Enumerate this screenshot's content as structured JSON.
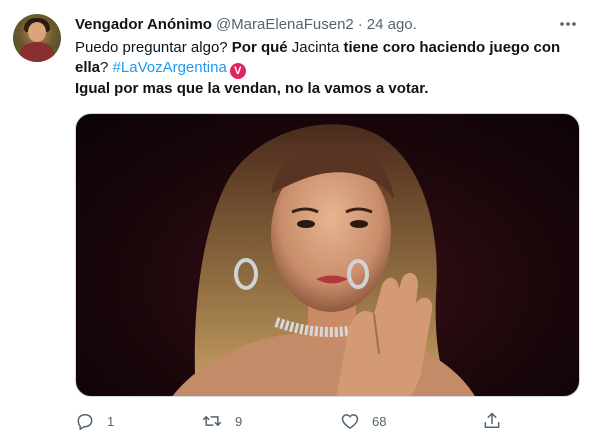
{
  "tweet": {
    "author_name": "Vengador Anónimo",
    "author_handle": "@MaraElenaFusen2",
    "separator": "·",
    "date": "24 ago.",
    "text": {
      "part1": "Puedo preguntar algo? ",
      "part2_bold": "Por qué",
      "part3": " Jacinta ",
      "part4_bold": "tiene coro haciendo juego con ella",
      "part5": "? ",
      "hashtag": "#LaVozArgentina",
      "hashtag_emoji": "V",
      "line2_bold": "Igual por mas que la vendan, no la vamos a votar."
    },
    "actions": {
      "replies": "1",
      "retweets": "9",
      "likes": "68"
    },
    "icons": {
      "more": "more-dots-icon",
      "reply": "reply-icon",
      "retweet": "retweet-icon",
      "like": "heart-icon",
      "share": "share-icon"
    },
    "colors": {
      "link": "#1d9bf0",
      "secondary_text": "#536471",
      "hashtag_emoji_bg": "#e0245e"
    }
  }
}
